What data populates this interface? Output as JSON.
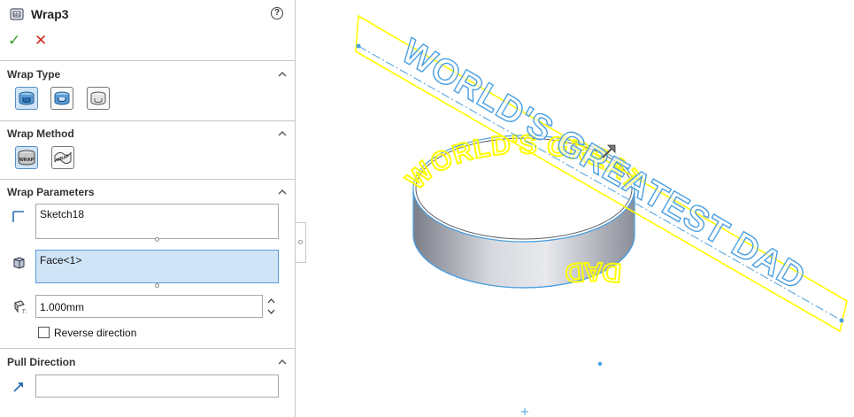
{
  "feature": {
    "title": "Wrap3",
    "help_glyph": "?",
    "ok_glyph": "✓",
    "cancel_glyph": "✕"
  },
  "wrap_type": {
    "title": "Wrap Type",
    "options": [
      "emboss",
      "deboss",
      "scribe"
    ],
    "selected": "emboss"
  },
  "wrap_method": {
    "title": "Wrap Method",
    "options": [
      "analytical",
      "spline-surface"
    ],
    "selected": "analytical"
  },
  "wrap_parameters": {
    "title": "Wrap Parameters",
    "source_sketch": "Sketch18",
    "face": "Face<1>",
    "thickness": "1.000mm",
    "reverse_direction_label": "Reverse direction",
    "reverse_direction_checked": false
  },
  "pull_direction": {
    "title": "Pull Direction",
    "value": ""
  },
  "graphics": {
    "sketch_text": "WORLD'S GREATEST DAD",
    "band_text_front": "WORLD'S GREATEST",
    "band_text_back": "DAD",
    "sketch_color": "#ffff00",
    "highlight_color": "#4a9fe0"
  },
  "colors": {
    "accent": "#5b9bd5",
    "selected_fill": "#cfe4f7",
    "ok": "#3a9a2c",
    "cancel": "#d22a20"
  }
}
